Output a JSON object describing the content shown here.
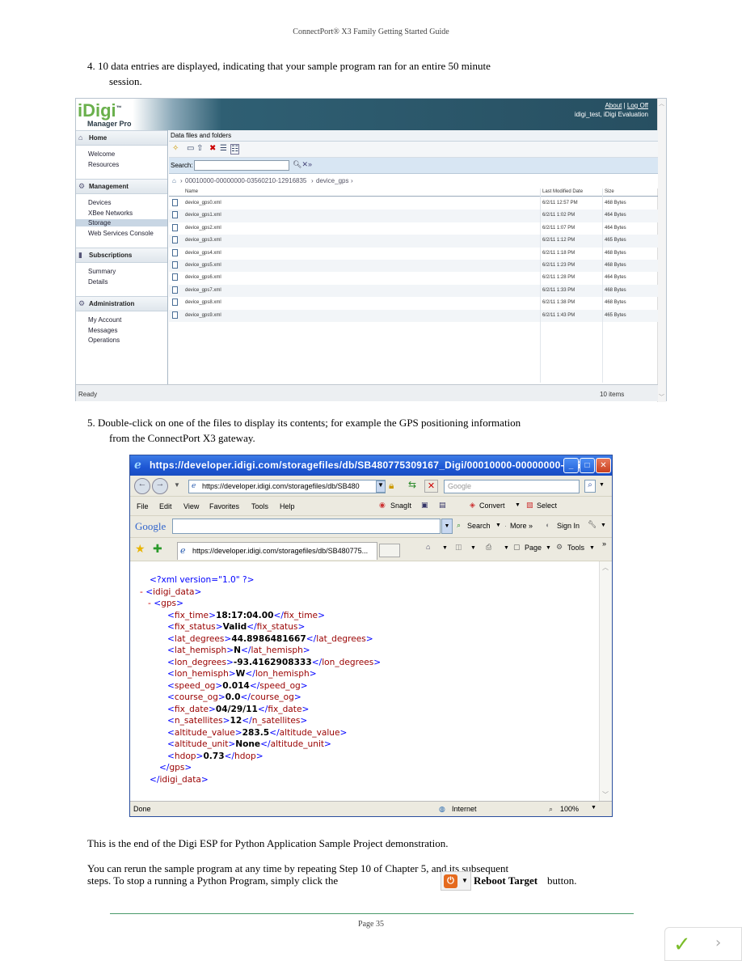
{
  "doc": {
    "header": "ConnectPort® X3 Family Getting Started Guide",
    "step4": "4.  10 data entries are displayed, indicating that your sample program ran for an entire 50 minute",
    "step4_cont": "session.",
    "step5": "5.  Double-click on one of the files to display its contents; for example the GPS positioning information",
    "step5_cont": "from the ConnectPort X3 gateway.",
    "end_text": "This is the end of the Digi ESP for Python Application Sample Project demonstration.",
    "rerun_1": "You can rerun the sample program at any time by repeating Step 10 of Chapter 5, and its subsequent",
    "rerun_2": "steps.  To stop a running a Python Program, simply click the",
    "reboot_label": "Reboot Target",
    "rerun_tail": "button.",
    "footer": "Page 35"
  },
  "idigi": {
    "logo": "iDigi",
    "logo_tm": "™",
    "logo_sub": "Manager Pro",
    "link_about": "About",
    "link_sep": " | ",
    "link_logoff": "Log Off",
    "user_line": "idigi_test, iDigi Evaluation",
    "sections": [
      {
        "title": "Home",
        "icon": "⌂",
        "items": [
          "Welcome",
          "Resources"
        ]
      },
      {
        "title": "Management",
        "icon": "⚙",
        "items": [
          "Devices",
          "XBee Networks",
          "Storage",
          "Web Services Console"
        ]
      },
      {
        "title": "Subscriptions",
        "icon": "▮",
        "items": [
          "Summary",
          "Details"
        ]
      },
      {
        "title": "Administration",
        "icon": "⚙",
        "items": [
          "My Account",
          "Messages",
          "Operations"
        ]
      }
    ],
    "selected_item": "Storage",
    "panel_title": "Data files and folders",
    "search_label": "Search:",
    "crumb_path": "00010000-00000000-03560210-12916835",
    "crumb_leaf": "device_gps",
    "columns": [
      "Name",
      "Last Modified Date",
      "Size"
    ],
    "rows": [
      [
        "device_gps0.xml",
        "6/2/11 12:57 PM",
        "468 Bytes"
      ],
      [
        "device_gps1.xml",
        "6/2/11 1:02 PM",
        "464 Bytes"
      ],
      [
        "device_gps2.xml",
        "6/2/11 1:07 PM",
        "464 Bytes"
      ],
      [
        "device_gps3.xml",
        "6/2/11 1:12 PM",
        "465 Bytes"
      ],
      [
        "device_gps4.xml",
        "6/2/11 1:18 PM",
        "468 Bytes"
      ],
      [
        "device_gps5.xml",
        "6/2/11 1:23 PM",
        "468 Bytes"
      ],
      [
        "device_gps6.xml",
        "6/2/11 1:28 PM",
        "464 Bytes"
      ],
      [
        "device_gps7.xml",
        "6/2/11 1:33 PM",
        "468 Bytes"
      ],
      [
        "device_gps8.xml",
        "6/2/11 1:38 PM",
        "468 Bytes"
      ],
      [
        "device_gps9.xml",
        "6/2/11 1:43 PM",
        "465 Bytes"
      ]
    ],
    "status_left": "Ready",
    "status_right": "10 items"
  },
  "ie": {
    "title": "https://developer.idigi.com/storagefiles/db/SB480775309167_Digi/00010000-00000000-035...",
    "address": "https://developer.idigi.com/storagefiles/db/SB480",
    "google_placeholder": "Google",
    "menu": [
      "File",
      "Edit",
      "View",
      "Favorites",
      "Tools",
      "Help"
    ],
    "snagit": "SnagIt",
    "convert": "Convert",
    "select": "Select",
    "google_logo": "Google",
    "gsearch": "Search",
    "more": "More »",
    "signin": "Sign In",
    "tab_label": "https://developer.idigi.com/storagefiles/db/SB480775...",
    "page_btn": "Page",
    "tools_btn": "Tools",
    "xml_decl": "<?xml version=\"1.0\" ?>",
    "root": "idigi_data",
    "gps": "gps",
    "fields": [
      {
        "tag": "fix_time",
        "value": "18:17:04.00"
      },
      {
        "tag": "fix_status",
        "value": "Valid"
      },
      {
        "tag": "lat_degrees",
        "value": "44.8986481667"
      },
      {
        "tag": "lat_hemisph",
        "value": "N"
      },
      {
        "tag": "lon_degrees",
        "value": "-93.4162908333"
      },
      {
        "tag": "lon_hemisph",
        "value": "W"
      },
      {
        "tag": "speed_og",
        "value": "0.014"
      },
      {
        "tag": "course_og",
        "value": "0.0"
      },
      {
        "tag": "fix_date",
        "value": "04/29/11"
      },
      {
        "tag": "n_satellites",
        "value": "12"
      },
      {
        "tag": "altitude_value",
        "value": "283.5"
      },
      {
        "tag": "altitude_unit",
        "value": "None"
      },
      {
        "tag": "hdop",
        "value": "0.73"
      }
    ],
    "status_done": "Done",
    "status_zone": "Internet",
    "zoom": "100%"
  }
}
